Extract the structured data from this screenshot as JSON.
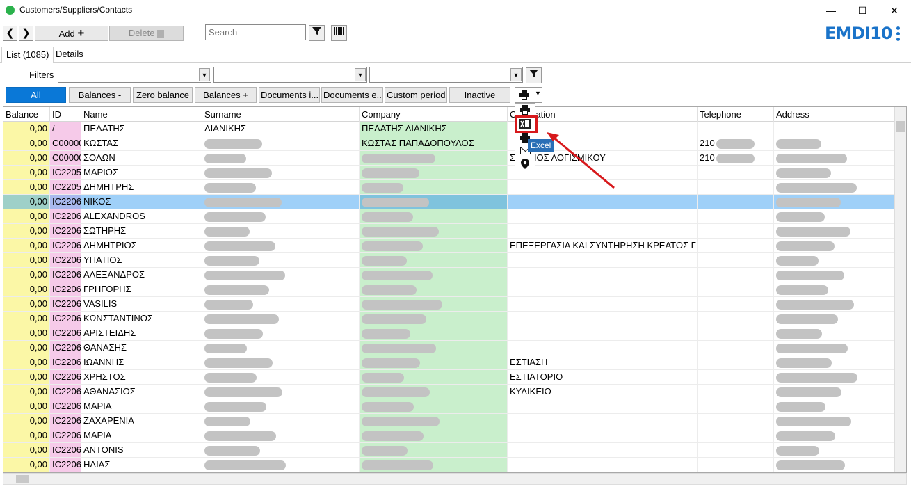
{
  "window": {
    "title": "Customers/Suppliers/Contacts",
    "minimize": "—",
    "maximize": "☐",
    "close": "✕"
  },
  "toolbar": {
    "back": "❮",
    "forward": "❯",
    "add": "Add",
    "add_icon": "plus-icon",
    "delete": "Delete",
    "search_placeholder": "Search"
  },
  "logo": "EMDI10",
  "tabs": [
    "List (1085)",
    "Details"
  ],
  "filters_label": "Filters",
  "quick_filters": [
    "All",
    "Balances -",
    "Zero balance",
    "Balances +",
    "Documents i...",
    "Documents e...",
    "Custom period",
    "Inactive"
  ],
  "export_menu": {
    "tooltip": "Excel",
    "items": [
      "printer-icon",
      "excel-icon",
      "print-form-icon",
      "email-icon",
      "location-icon"
    ]
  },
  "columns": [
    "Balance",
    "ID",
    "Name",
    "Surname",
    "Company",
    "Occupation",
    "Telephone",
    "Address"
  ],
  "occupation_header_partial": "C",
  "occupation_header_rest": "ation",
  "rows": [
    {
      "balance": "0,00",
      "id": "/",
      "name": "ΠΕΛΑΤΗΣ",
      "surname": "ΛΙΑΝΙΚΗΣ",
      "company": "ΠΕΛΑΤΗΣ ΛΙΑΝΙΚΗΣ",
      "occupation": "",
      "telephone": ""
    },
    {
      "balance": "0,00",
      "id": "C00000",
      "name": "ΚΩΣΤΑΣ",
      "surname": "",
      "company": "ΚΩΣΤΑΣ ΠΑΠΑΔΟΠΟΥΛΟΣ",
      "occupation": "",
      "telephone": "210"
    },
    {
      "balance": "0,00",
      "id": "C00000",
      "name": "ΣΟΛΩΝ",
      "surname": "",
      "company": "",
      "occupation": "Σ ΑΣΜΟΣ ΛΟΓΙΣΜΙΚΟΥ",
      "telephone": "210"
    },
    {
      "balance": "0,00",
      "id": "IC2205",
      "name": "ΜΑΡΙΟΣ",
      "surname": "",
      "company": "",
      "occupation": "",
      "telephone": ""
    },
    {
      "balance": "0,00",
      "id": "IC2205",
      "name": "ΔΗΜΗΤΡΗΣ",
      "surname": "",
      "company": "",
      "occupation": "",
      "telephone": ""
    },
    {
      "balance": "0,00",
      "id": "IC2206",
      "name": "ΝΙΚΟΣ",
      "surname": "",
      "company": "",
      "occupation": "",
      "telephone": ""
    },
    {
      "balance": "0,00",
      "id": "IC2206",
      "name": "ALEXANDROS",
      "surname": "",
      "company": "",
      "occupation": "",
      "telephone": ""
    },
    {
      "balance": "0,00",
      "id": "IC2206",
      "name": "ΣΩΤΗΡΗΣ",
      "surname": "",
      "company": "",
      "occupation": "",
      "telephone": ""
    },
    {
      "balance": "0,00",
      "id": "IC2206",
      "name": "ΔΗΜΗΤΡΙΟΣ",
      "surname": "",
      "company": "",
      "occupation": "ΕΠΕΞΕΡΓΑΣΙΑ ΚΑΙ ΣΥΝΤΗΡΗΣΗ ΚΡΕΑΤΟΣ Γ",
      "telephone": ""
    },
    {
      "balance": "0,00",
      "id": "IC2206",
      "name": "ΥΠΑΤΙΟΣ",
      "surname": "",
      "company": "",
      "occupation": "",
      "telephone": ""
    },
    {
      "balance": "0,00",
      "id": "IC2206",
      "name": "ΑΛΕΞΑΝΔΡΟΣ",
      "surname": "",
      "company": "",
      "occupation": "",
      "telephone": ""
    },
    {
      "balance": "0,00",
      "id": "IC2206",
      "name": "ΓΡΗΓΟΡΗΣ",
      "surname": "",
      "company": "",
      "occupation": "",
      "telephone": ""
    },
    {
      "balance": "0,00",
      "id": "IC2206",
      "name": "VASILIS",
      "surname": "",
      "company": "",
      "occupation": "",
      "telephone": ""
    },
    {
      "balance": "0,00",
      "id": "IC2206",
      "name": "ΚΩΝΣΤΑΝΤΙΝΟΣ",
      "surname": "",
      "company": "",
      "occupation": "",
      "telephone": ""
    },
    {
      "balance": "0,00",
      "id": "IC2206",
      "name": "ΑΡΙΣΤΕΙΔΗΣ",
      "surname": "",
      "company": "",
      "occupation": "",
      "telephone": ""
    },
    {
      "balance": "0,00",
      "id": "IC2206",
      "name": "ΘΑΝΑΣΗΣ",
      "surname": "",
      "company": "",
      "occupation": "",
      "telephone": ""
    },
    {
      "balance": "0,00",
      "id": "IC2206",
      "name": "ΙΩΑΝΝΗΣ",
      "surname": "",
      "company": "",
      "occupation": "ΕΣΤΙΑΣΗ",
      "telephone": ""
    },
    {
      "balance": "0,00",
      "id": "IC2206",
      "name": "ΧΡΗΣΤΟΣ",
      "surname": "",
      "company": "",
      "occupation": "ΕΣΤΙΑΤΟΡΙΟ",
      "telephone": ""
    },
    {
      "balance": "0,00",
      "id": "IC2206",
      "name": "ΑΘΑΝΑΣΙΟΣ",
      "surname": "",
      "company": "",
      "occupation": "ΚΥΛΙΚΕΙΟ",
      "telephone": ""
    },
    {
      "balance": "0,00",
      "id": "IC2206",
      "name": "ΜΑΡΙΑ",
      "surname": "",
      "company": "",
      "occupation": "",
      "telephone": ""
    },
    {
      "balance": "0,00",
      "id": "IC2206",
      "name": "ΖΑΧΑΡΕΝΙΑ",
      "surname": "",
      "company": "",
      "occupation": "",
      "telephone": ""
    },
    {
      "balance": "0,00",
      "id": "IC2206",
      "name": "ΜΑΡΙΑ",
      "surname": "",
      "company": "",
      "occupation": "",
      "telephone": ""
    },
    {
      "balance": "0,00",
      "id": "IC2206",
      "name": "ANTONIS",
      "surname": "",
      "company": "",
      "occupation": "",
      "telephone": ""
    },
    {
      "balance": "0,00",
      "id": "IC2206",
      "name": "ΗΛΙΑΣ",
      "surname": "",
      "company": "",
      "occupation": "",
      "telephone": ""
    }
  ],
  "selected_row": 5,
  "colors": {
    "accent": "#0a78d7",
    "balance_col": "#fbf7a6",
    "id_col": "#f6cae9",
    "company_col": "#c9efcc",
    "selected": "#9fd0f8",
    "highlight": "#d7191c"
  }
}
